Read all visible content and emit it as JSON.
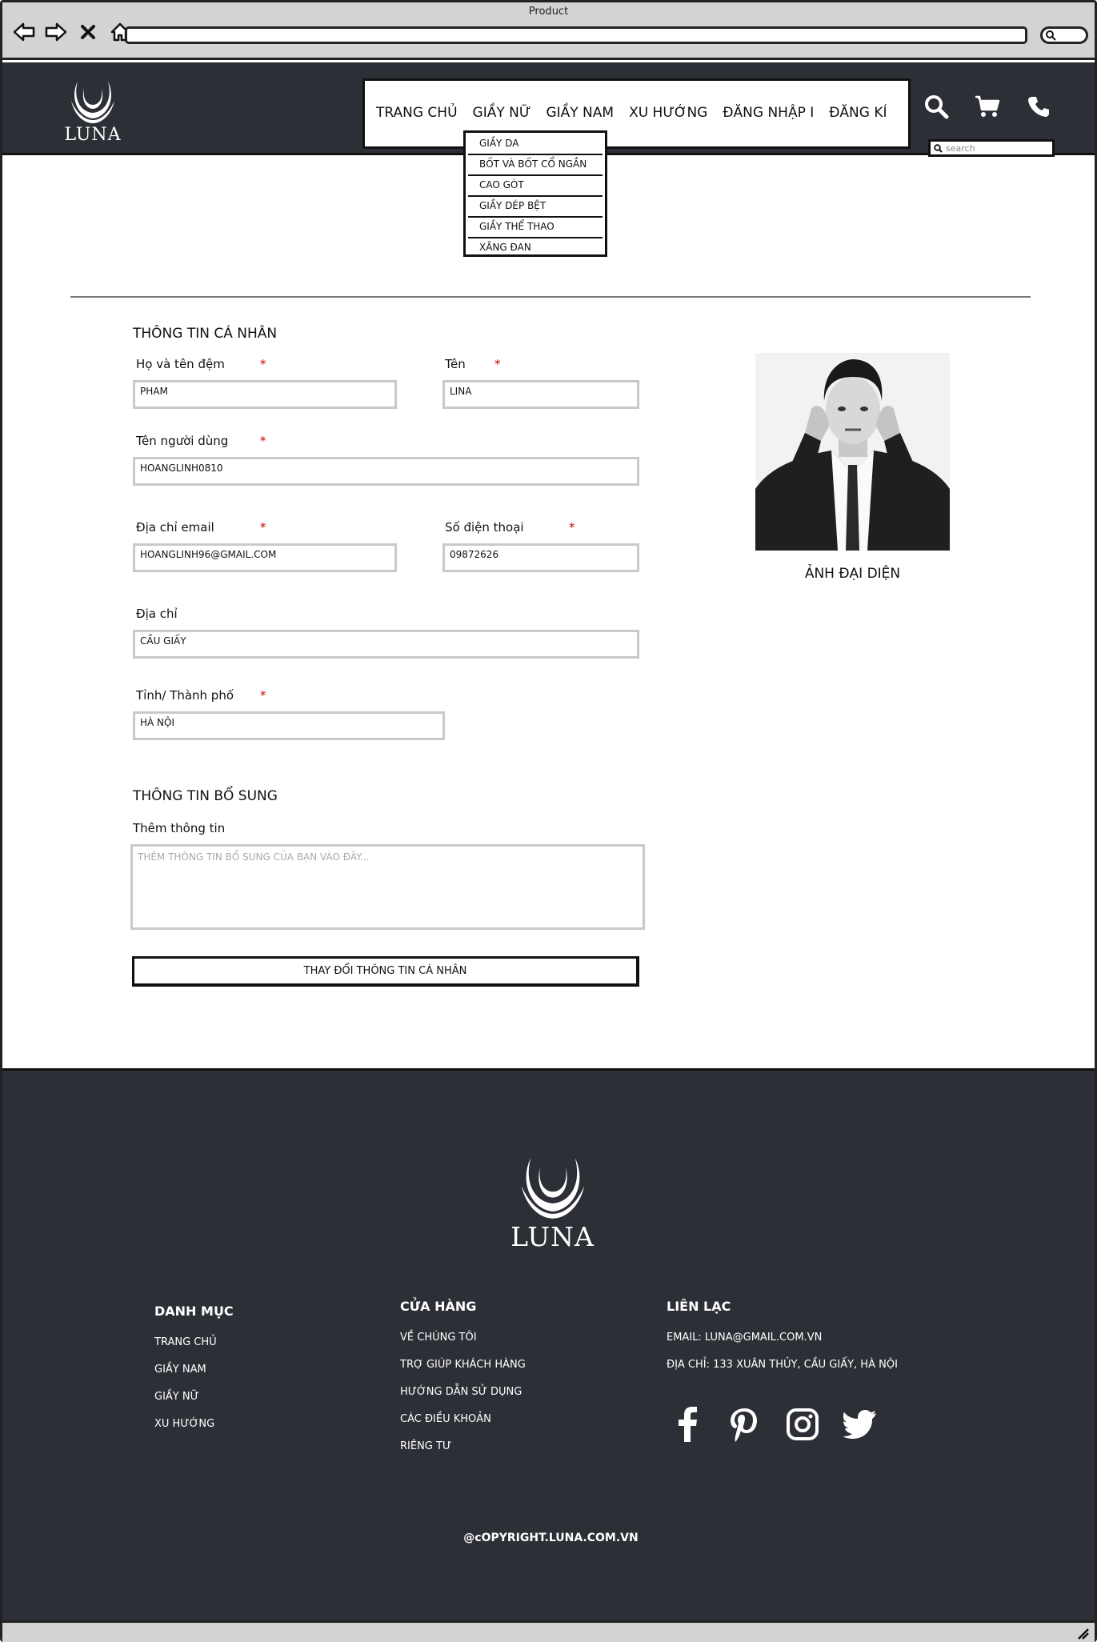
{
  "window": {
    "title": "Product"
  },
  "header": {
    "logo_text": "LUNA",
    "menu": [
      "TRANG CHỦ",
      "GIẦY NỮ",
      "GIẦY NAM",
      "XU HƯỚNG",
      "ĐĂNG NHẬP I",
      "ĐĂNG KÍ"
    ],
    "search_placeholder": "search",
    "icons": [
      "search-icon",
      "cart-icon",
      "phone-icon"
    ]
  },
  "dropdown": {
    "items": [
      "GIẦY DA",
      "BỐT VÀ BỐT CỔ NGẮN",
      "CAO GÓT",
      "GIẦY DÉP BỆT",
      "GIẦY THỂ THAO",
      "XĂNG ĐAN"
    ]
  },
  "personal": {
    "section_title": "THÔNG TIN CÁ NHÂN",
    "required_mark": "*",
    "fields": {
      "middle_name": {
        "label": "Họ và tên đệm",
        "value": "PHAM"
      },
      "first_name": {
        "label": "Tên",
        "value": "LINA"
      },
      "username": {
        "label": "Tên người dùng",
        "value": "HOANGLINH0810"
      },
      "email": {
        "label": "Địa chỉ email",
        "value": "HOANGLINH96@GMAIL.COM"
      },
      "phone": {
        "label": "Số điện thoại",
        "value": "09872626"
      },
      "address": {
        "label": "Địa chỉ",
        "value": "CẦU GIẤY"
      },
      "city": {
        "label": "Tỉnh/ Thành phố",
        "value": "HÀ NỘI"
      }
    },
    "avatar_caption": "ẢNH ĐẠI DIỆN"
  },
  "extra": {
    "section_title": "THÔNG TIN BỔ SUNG",
    "label": "Thêm thông tin",
    "placeholder": "THÊM THÔNG TIN BỔ SUNG CỦA BẠN VÀO ĐÂY...",
    "submit_label": "THAY ĐỔI THÔNG TIN CÁ NHÂN"
  },
  "footer": {
    "logo_text": "LUNA",
    "columns": [
      {
        "title": "DANH MỤC",
        "links": [
          "TRANG CHỦ",
          "GIẦY NAM",
          "GIẦY NỮ",
          "XU HƯỚNG"
        ]
      },
      {
        "title": "CỬA HÀNG",
        "links": [
          "VỀ CHÚNG TÔI",
          "TRỢ GIÚP KHÁCH HÀNG",
          "HƯỚNG DẪN SỬ DỤNG",
          "CÁC ĐIỀU KHOẢN",
          "RIÊNG TƯ"
        ]
      },
      {
        "title": "LIÊN LẠC",
        "links": [
          "EMAIL: LUNA@GMAIL.COM.VN",
          "ĐỊA CHỈ: 133 XUÂN THỦY, CẦU GIẤY, HÀ NỘI"
        ]
      }
    ],
    "socials": [
      "facebook-icon",
      "pinterest-icon",
      "instagram-icon",
      "twitter-icon"
    ],
    "copyright": "@cOPYRIGHT.LUNA.COM.VN"
  },
  "colors": {
    "header_bg": "#2d2f36",
    "required": "#cc0000",
    "chrome": "#d3d3d3"
  }
}
